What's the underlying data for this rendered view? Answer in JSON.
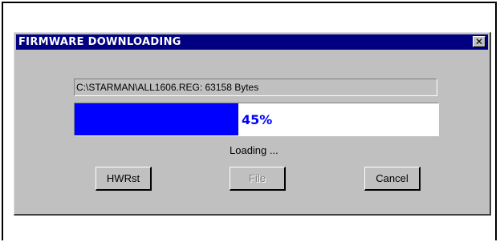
{
  "dialog": {
    "title": "FIRMWARE DOWNLOADING",
    "close_glyph": "✕",
    "file_info": "C:\\STARMAN\\ALL1606.REG: 63158 Bytes",
    "progress": {
      "percent": 45,
      "label": "45%",
      "fill_color": "#0000ff"
    },
    "status": "Loading ...",
    "buttons": {
      "hwrst": {
        "label": "HWRst",
        "enabled": true
      },
      "file": {
        "label": "File",
        "enabled": false
      },
      "cancel": {
        "label": "Cancel",
        "enabled": true
      }
    }
  }
}
